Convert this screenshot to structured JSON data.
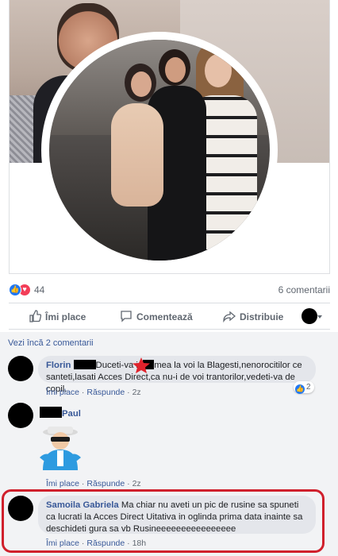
{
  "post": {
    "reaction_count": "44",
    "comment_count": "6 comentarii"
  },
  "actions": {
    "like": "Îmi place",
    "comment": "Comentează",
    "share": "Distribuie"
  },
  "comments_section": {
    "more_label": "Vezi încă 2 comentarii",
    "comments": [
      {
        "author": "Florin",
        "text_part1": "Duceti-va in",
        "text_part2": "mea la voi la Blagesti,nenorocitilor ce santeti,lasati Acces Direct,ca nu-i de voi trantorilor,vedeti-va de copil.",
        "like": "Îmi place",
        "reply": "Răspunde",
        "time": "2z",
        "like_count": "2"
      },
      {
        "author": "Paul",
        "like": "Îmi place",
        "reply": "Răspunde",
        "time": "2z"
      },
      {
        "author": "Samoila Gabriela",
        "text": "Ma chiar nu aveti un pic de rusine sa spuneti ca lucrati la Acces Direct Uitativa in oglinda prima data inainte sa deschideti gura sa vb Rusineeeeeeeeeeeeeeee",
        "like": "Îmi place",
        "reply": "Răspunde",
        "time": "18h"
      }
    ]
  },
  "colors": {
    "link": "#385898",
    "like_blue": "#2078f4",
    "love_red": "#f33e58",
    "highlight_red": "#d0202c",
    "bubble": "#e4e6eb"
  }
}
